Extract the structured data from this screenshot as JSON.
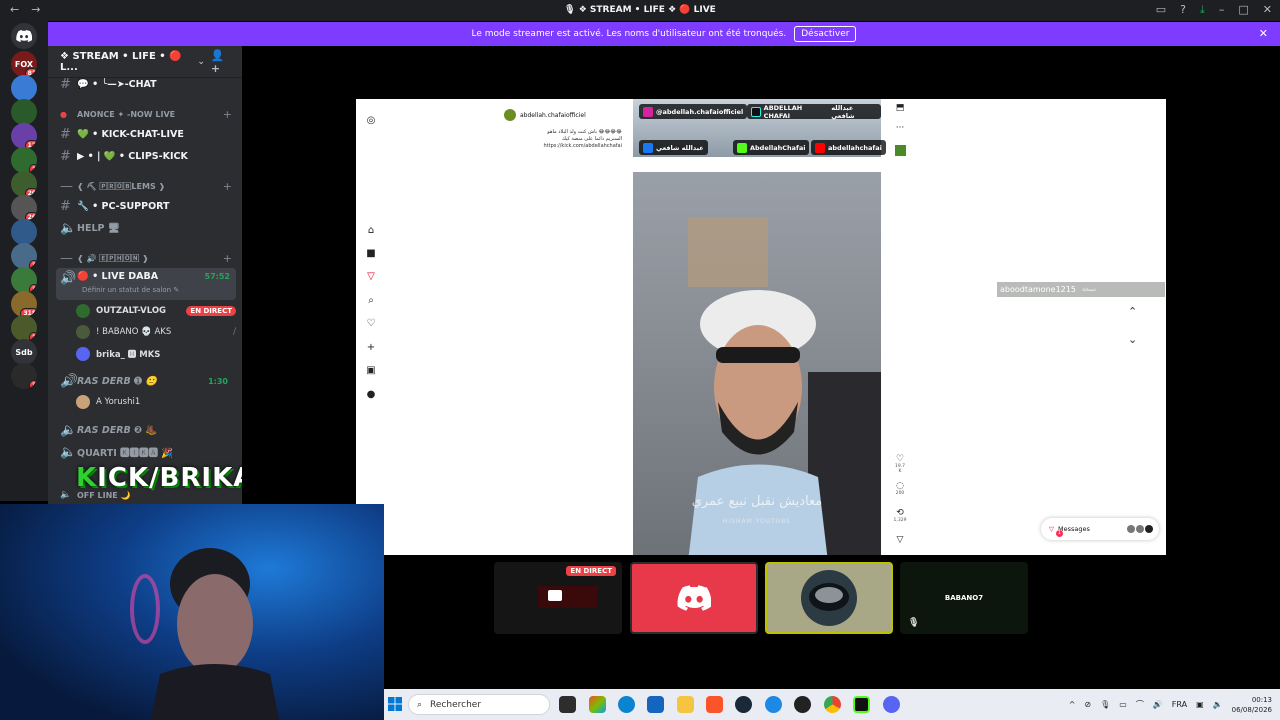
{
  "window": {
    "title": "🎙 ❖ STREAM • LIFE ❖ 🔴 LIVE",
    "nav_back": "←",
    "nav_forward": "→"
  },
  "banner": {
    "message": "Le mode streamer est activé. Les noms d'utilisateur ont été tronqués.",
    "button": "Désactiver",
    "close": "✕"
  },
  "guilds": [
    {
      "label": "FOX",
      "badge": "81",
      "color": "#7a1b1b"
    },
    {
      "label": "",
      "badge": "",
      "color": "#3a7bd5"
    },
    {
      "label": "",
      "badge": "",
      "color": "#2a5a2a"
    },
    {
      "label": "",
      "badge": "12",
      "color": "#6a3fa8"
    },
    {
      "label": "",
      "badge": "1",
      "color": "#2f6b2f"
    },
    {
      "label": "",
      "badge": "20",
      "color": "#3d5d2f"
    },
    {
      "label": "",
      "badge": "26",
      "color": "#555"
    },
    {
      "label": "",
      "badge": "",
      "color": "#2f5a8a"
    },
    {
      "label": "",
      "badge": "3",
      "color": "#4a6a8a"
    },
    {
      "label": "",
      "badge": "3",
      "color": "#3a7a3a"
    },
    {
      "label": "",
      "badge": "318",
      "color": "#8a6a2a"
    },
    {
      "label": "",
      "badge": "1",
      "color": "#4a5a2a"
    },
    {
      "label": "Sdb",
      "badge": "",
      "color": "#313338"
    },
    {
      "label": "",
      "badge": "3",
      "color": "#2a2a2a"
    }
  ],
  "server": {
    "name": "❖ STREAM • LIFE • 🔴 L...",
    "invite_icon": "👤+"
  },
  "channels": {
    "chat": "💬 • ╰—➤-CHAT",
    "announce_cat": "ANONCE ✦ -NOW LIVE",
    "kick_chat": "💚 • KICK-CHAT-LIVE",
    "clips": "▶ • | 💚 • CLIPS-KICK",
    "problems_cat": "❰ ⛏ 🄿🅁🄾🄱LEMS ❱",
    "pc_support": "🔧 • PC-SUPPORT",
    "help": "HELP 🖥",
    "voice_cat": "❰ 🔊 🄴🄿🄷🄾🄽 ❱",
    "live_daba": "🔴 • LIVE DABA",
    "live_time": "57:52",
    "live_status": "Définir un statut de salon ✎",
    "user1": "OUTZALT-VLOG",
    "user1_badge": "EN DIRECT",
    "user2": "! BABANO 💀 AKS",
    "user3": "brika_ 🅼 MKS",
    "ras_derb1": "RAS DERB ➊ 🙂",
    "ras_derb1_time": "1:30",
    "user4": "A Yorushi1",
    "ras_derb2": "RAS DERB ❷ 🥾",
    "quarti": "QUARTI 🅺🅸🅺🅰 🎉",
    "offline": "OFF LINE 🌙"
  },
  "overlay": {
    "k": "K",
    "rest": "ICK/BRIKAO"
  },
  "tiktok": {
    "username": "abdellah.chafaiofficiel",
    "caption_ar": "باش كنت ولد البلاد ماهو 😂😂😂😂",
    "caption_ar2": "الستريم دائما على منصة كيك",
    "caption_link": "https://kick.com/abdellahchafai",
    "social_ig": "@abdellah.chafaiofficiel",
    "social_tt": "ABDELLAH CHAFAI",
    "social_tt_ar": "عبدالله شافعي",
    "social_fb": "عبدالله شافعي",
    "social_kick": "AbdellahChafai",
    "social_yt": "abdellahchafai",
    "subtitle": "معاديش نقبل نبيع عمري",
    "watermark": "HISHAM YOUTUBE",
    "likes": "19.7 K",
    "comments": "200",
    "shares": "1,329",
    "chat_user": "aboodtamone1215",
    "chat_tag": "نسخة",
    "messages_label": "Messages",
    "messages_count": "1"
  },
  "tiles": {
    "tile1_live": "EN DIRECT",
    "tile4_name": "BABANO7"
  },
  "taskbar": {
    "search_placeholder": "Rechercher",
    "lang": "FRA",
    "time": "00:13",
    "date": "06/08/2026",
    "up_arrow": "^"
  },
  "colors": {
    "discord_blurple": "#5865f2",
    "banner_purple": "#7d3cff",
    "live_red": "#ed4245",
    "online_green": "#23a55a"
  }
}
